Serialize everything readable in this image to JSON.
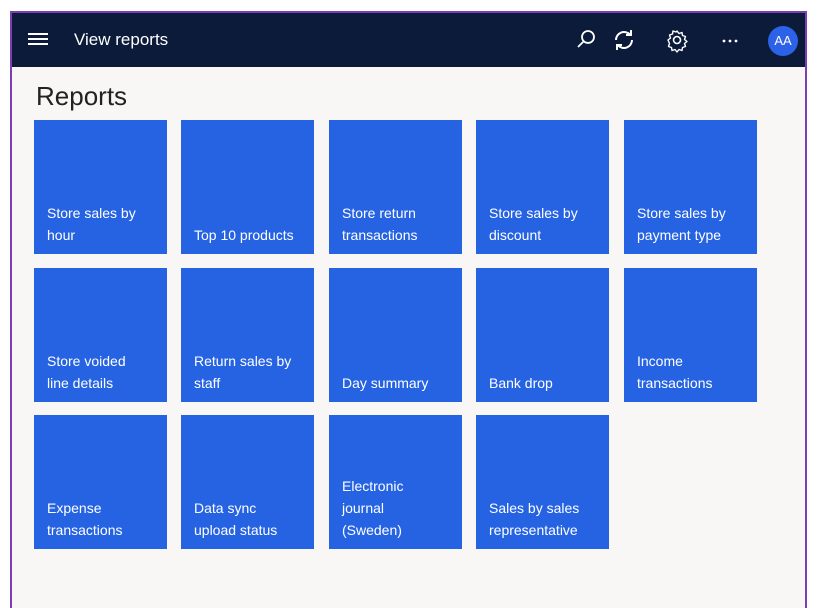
{
  "header": {
    "app_title": "View reports",
    "avatar_initials": "AA",
    "icons": [
      "menu-icon",
      "search-icon",
      "refresh-icon",
      "gear-icon",
      "more-icon"
    ]
  },
  "page": {
    "title": "Reports"
  },
  "tiles": [
    {
      "label": "Store sales by\nhour"
    },
    {
      "label": "Top 10 products"
    },
    {
      "label": "Store return\ntransactions"
    },
    {
      "label": "Store sales by\ndiscount"
    },
    {
      "label": "Store sales by\npayment type"
    },
    {
      "label": "Store voided\nline details"
    },
    {
      "label": "Return sales by\nstaff"
    },
    {
      "label": "Day summary"
    },
    {
      "label": "Bank drop"
    },
    {
      "label": "Income\ntransactions"
    },
    {
      "label": "Expense\ntransactions"
    },
    {
      "label": "Data sync\nupload status"
    },
    {
      "label": "Electronic\njournal\n(Sweden)"
    },
    {
      "label": "Sales by sales\nrepresentative"
    }
  ],
  "colors": {
    "topbar": "#0c1b3a",
    "tile": "#2563e3",
    "avatar": "#2c62e8",
    "border": "#7b3fb3"
  }
}
